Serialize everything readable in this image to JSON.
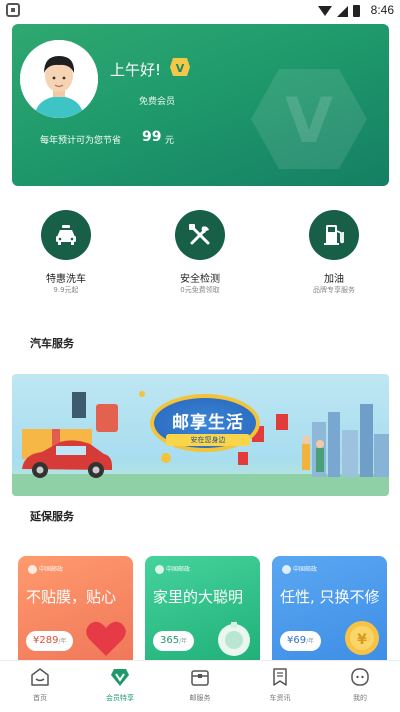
{
  "status_bar": {
    "time": "8:46"
  },
  "member_card": {
    "greeting": "上午好!",
    "level": "免费会员",
    "saving_label": "每年预计可为您节省",
    "saving_amount": "99",
    "saving_unit": "元",
    "vip_badge_letter": "V",
    "emblem_letter": "V"
  },
  "quick_services": [
    {
      "title": "特惠洗车",
      "subtitle": "9.9元起",
      "icon": "car-wash-icon"
    },
    {
      "title": "安全检测",
      "subtitle": "0元免费领取",
      "icon": "tools-icon"
    },
    {
      "title": "加油",
      "subtitle": "品牌专享服务",
      "icon": "fuel-pump-icon"
    }
  ],
  "sections": {
    "car_service": "汽车服务",
    "warranty_service": "延保服务"
  },
  "banner": {
    "title": "邮享生活",
    "subtitle": "安在您身边"
  },
  "warranty_cards": [
    {
      "logo": "中国邮政",
      "headline": "不贴膜，贴心",
      "price": "¥289",
      "price_unit": "/年",
      "bg": "#f0785a"
    },
    {
      "logo": "中国邮政",
      "headline": "家里的大聪明",
      "price": "365",
      "price_unit": "/年",
      "bg": "#2fbf8a"
    },
    {
      "logo": "中国邮政",
      "headline": "任性, 只换不修",
      "price": "¥69",
      "price_unit": "/年",
      "bg": "#3f8ee6"
    }
  ],
  "bottom_nav": [
    {
      "label": "首页",
      "icon": "home-icon",
      "active": false
    },
    {
      "label": "会员特享",
      "icon": "vip-heart-icon",
      "active": true
    },
    {
      "label": "邮服务",
      "icon": "box-icon",
      "active": false
    },
    {
      "label": "车资讯",
      "icon": "news-icon",
      "active": false
    },
    {
      "label": "我的",
      "icon": "profile-icon",
      "active": false
    }
  ],
  "colors": {
    "brand_green": "#1f9a6c",
    "icon_dark_green": "#175f47"
  }
}
